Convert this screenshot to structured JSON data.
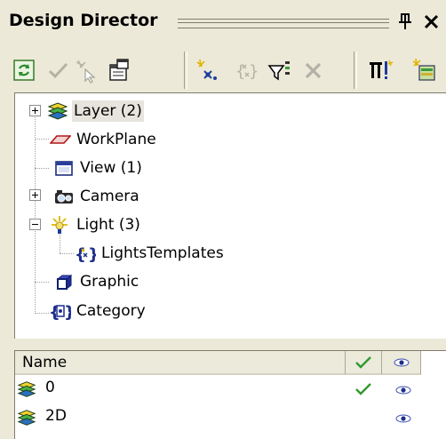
{
  "window": {
    "title": "Design Director",
    "pin_icon": "pin-icon",
    "close_icon": "close-icon"
  },
  "toolbar": {
    "buttons": [
      {
        "icon": "refresh-icon",
        "enabled": true
      },
      {
        "icon": "check-icon",
        "enabled": false
      },
      {
        "icon": "select-tool-icon",
        "enabled": false
      },
      {
        "icon": "properties-icon",
        "enabled": true
      },
      {
        "icon": "new-item-icon",
        "enabled": true
      },
      {
        "icon": "template-icon",
        "enabled": false
      },
      {
        "icon": "filter-icon",
        "enabled": true
      },
      {
        "icon": "delete-icon",
        "enabled": false
      },
      {
        "icon": "settings-icon",
        "enabled": true
      },
      {
        "icon": "new-layer-icon",
        "enabled": true
      }
    ]
  },
  "tree": {
    "items": [
      {
        "label": "Layer (2)",
        "icon": "layer-icon",
        "expandable": true,
        "expanded": false,
        "selected": true
      },
      {
        "label": "WorkPlane",
        "icon": "workplane-icon",
        "expandable": false
      },
      {
        "label": "View (1)",
        "icon": "view-icon",
        "expandable": false
      },
      {
        "label": "Camera",
        "icon": "camera-icon",
        "expandable": true,
        "expanded": false
      },
      {
        "label": "Light (3)",
        "icon": "light-icon",
        "expandable": true,
        "expanded": true
      },
      {
        "label": "LightsTemplates",
        "icon": "template-icon",
        "expandable": false,
        "child": true
      },
      {
        "label": "Graphic",
        "icon": "graphic-icon",
        "expandable": false
      },
      {
        "label": "Category",
        "icon": "category-icon",
        "expandable": false
      }
    ]
  },
  "list": {
    "columns": [
      {
        "label": "Name"
      },
      {
        "icon": "check-icon"
      },
      {
        "icon": "eye-icon"
      }
    ],
    "rows": [
      {
        "name": "0",
        "active": true,
        "visible": true
      },
      {
        "name": "2D",
        "active": false,
        "visible": true
      }
    ]
  },
  "colors": {
    "panel_bg": "#ece9d8",
    "check_green": "#2f9a2f",
    "eye_blue": "#3a4fb0"
  }
}
